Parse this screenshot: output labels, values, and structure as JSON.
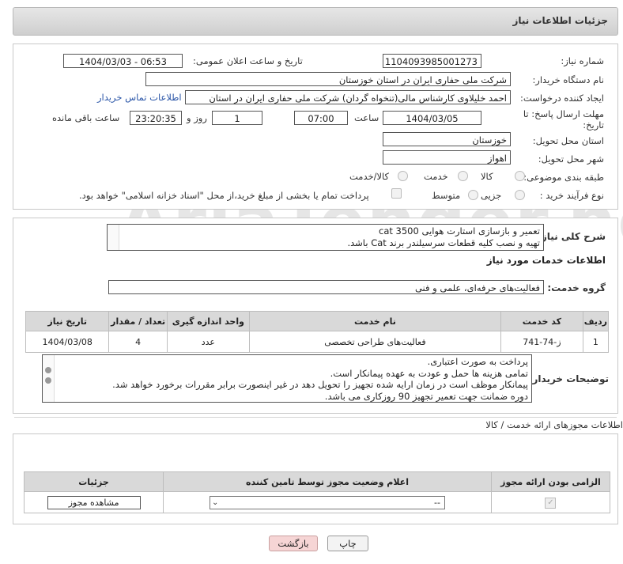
{
  "header": {
    "title": "جزئیات اطلاعات نیاز"
  },
  "form": {
    "need_number_label": "شماره نیاز:",
    "need_number": "1104093985001273",
    "announce_label": "تاریخ و ساعت اعلان عمومی:",
    "announce_value": "1404/03/03 - 06:53",
    "buyer_label": "نام دستگاه خریدار:",
    "buyer_value": "شرکت ملی حفاری ایران در استان خوزستان",
    "creator_label": "ایجاد کننده درخواست:",
    "creator_value": "احمد خلیلاوی کارشناس مالی(تنخواه گردان) شرکت ملی حفاری ایران در استان",
    "contact_link": "اطلاعات تماس خریدار",
    "deadline_label": "مهلت ارسال پاسخ: تا تاریخ:",
    "deadline_date": "1404/03/05",
    "time_label": "ساعت",
    "deadline_time": "07:00",
    "days_value": "1",
    "days_label": "روز و",
    "remaining_time": "23:20:35",
    "remaining_label": "ساعت باقی مانده",
    "province_label": "استان محل تحویل:",
    "province_value": "خوزستان",
    "city_label": "شهر محل تحویل:",
    "city_value": "اهواز",
    "category_label": "طبقه بندی موضوعی:",
    "category_options": [
      "کالا",
      "خدمت",
      "کالا/خدمت"
    ],
    "process_label": "نوع فرآیند خرید :",
    "process_options": [
      "جزیی",
      "متوسط"
    ],
    "payment_note": "پرداخت تمام یا بخشی از مبلغ خرید،از محل \"اسناد خزانه اسلامی\" خواهد بود."
  },
  "description": {
    "label": "شرح کلی نیاز:",
    "lines": [
      "تعمیر و بازسازی استارت هوایی cat 3500",
      "تهیه و نصب کلیه قطعات سرسیلندر برند Cat باشد."
    ]
  },
  "services": {
    "title": "اطلاعات خدمات مورد نیاز",
    "group_label": "گروه خدمت:",
    "group_value": "فعالیت‌های حرفه‌ای، علمی و فنی",
    "columns": [
      "ردیف",
      "کد خدمت",
      "نام خدمت",
      "واحد اندازه گیری",
      "تعداد / مقدار",
      "تاریخ نیاز"
    ],
    "rows": [
      {
        "index": "1",
        "code": "ز-74-741",
        "name": "فعالیت‌های طراحی تخصصی",
        "unit": "عدد",
        "qty": "4",
        "date": "1404/03/08"
      }
    ]
  },
  "buyer_notes": {
    "label": "توضیحات خریدار:",
    "lines": [
      "پرداخت به صورت اعتباری.",
      "تمامی هزینه ها حمل و عودت به عهده پیمانکار است.",
      "پیمانکار موظف است در زمان ارایه شده تجهیز را تحویل دهد در غیر اینصورت برابر مقررات برخورد خواهد شد.",
      "دوره ضمانت جهت تعمیر تجهیز  90 روزکاری می باشد."
    ]
  },
  "permits": {
    "title": "اطلاعات مجوزهای ارائه خدمت / کالا",
    "columns": [
      "الزامی بودن ارائه مجوز",
      "اعلام وضعیت مجوز توسط تامین کننده",
      "جزئیات"
    ],
    "select_value": "--",
    "view_button": "مشاهده مجوز"
  },
  "footer": {
    "print_button": "چاپ",
    "back_button": "بازگشت"
  },
  "watermark": {
    "text": "AriaTender.neT"
  },
  "colors": {
    "link": "#2b56a8",
    "back_button_bg": "#f6d5d5",
    "header_bg": "#d9d9d9"
  }
}
